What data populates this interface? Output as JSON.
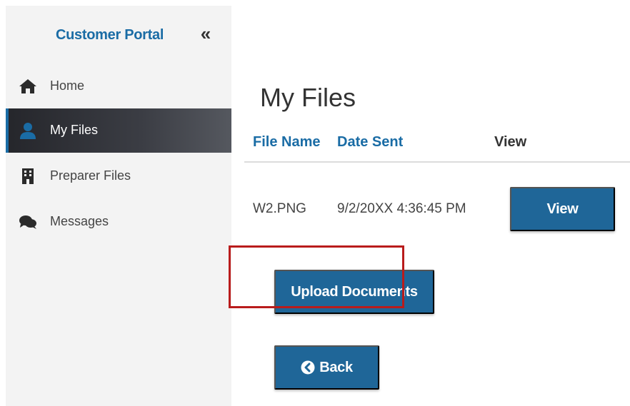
{
  "sidebar": {
    "title": "Customer Portal",
    "collapse_icon": "double-chevron-left-icon",
    "items": [
      {
        "label": "Home",
        "icon": "home-icon",
        "active": false
      },
      {
        "label": "My Files",
        "icon": "user-icon",
        "active": true
      },
      {
        "label": "Preparer Files",
        "icon": "building-icon",
        "active": false
      },
      {
        "label": "Messages",
        "icon": "chat-bubbles-icon",
        "active": false
      }
    ]
  },
  "main": {
    "title": "My Files",
    "table": {
      "headers": [
        "File Name",
        "Date Sent",
        "View"
      ],
      "rows": [
        {
          "file_name": "W2.PNG",
          "date_sent": "9/2/20XX 4:36:45 PM",
          "action_label": "View"
        }
      ]
    },
    "upload_label": "Upload Documents",
    "back_label": "Back"
  },
  "colors": {
    "accent": "#1a6ca5",
    "button": "#1f6698",
    "sidebar_bg": "#f3f3f3",
    "active_bg": "#2d2f35",
    "highlight": "#b91c1c"
  }
}
